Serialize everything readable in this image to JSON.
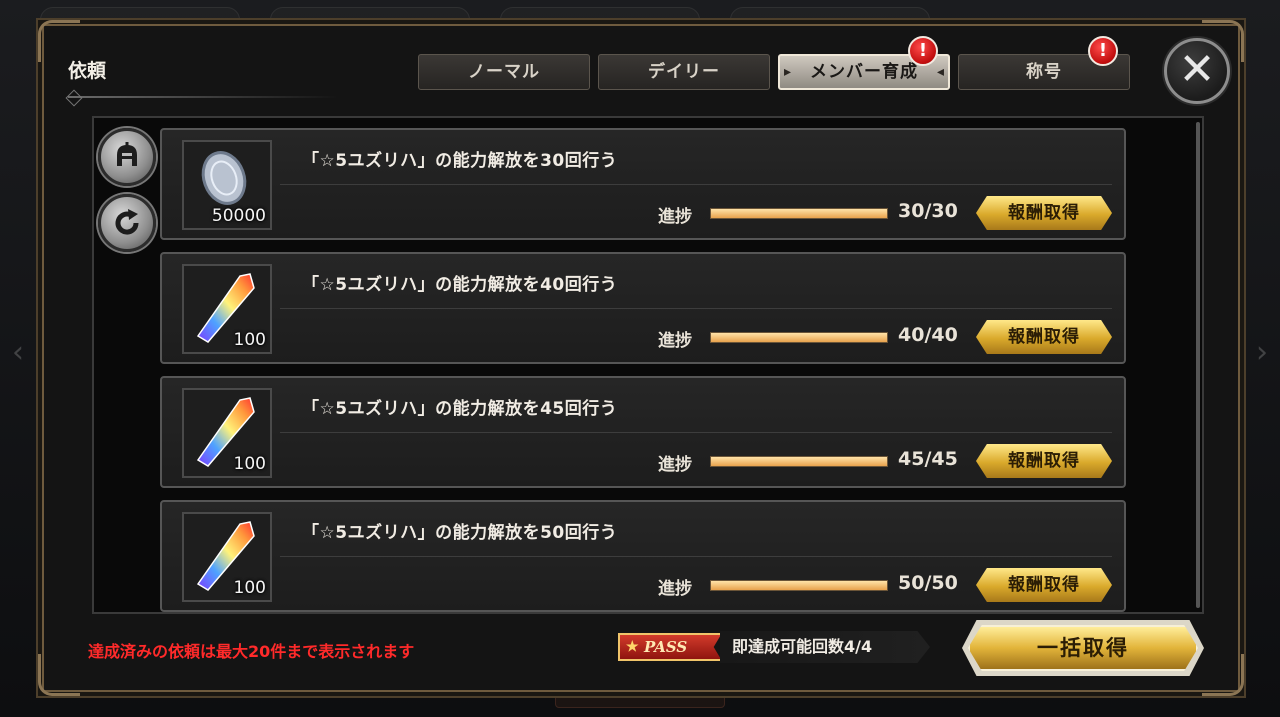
{
  "dialog": {
    "title": "依頼",
    "close_label": "✕"
  },
  "tabs": [
    {
      "label": "ノーマル",
      "active": false,
      "badge": false
    },
    {
      "label": "デイリー",
      "active": false,
      "badge": false
    },
    {
      "label": "メンバー育成",
      "active": true,
      "badge": true
    },
    {
      "label": "称号",
      "active": false,
      "badge": true
    }
  ],
  "badge_symbol": "!",
  "side_buttons": [
    {
      "name": "helmet-icon"
    },
    {
      "name": "refresh-icon"
    }
  ],
  "progress_label": "進捗",
  "quests": [
    {
      "text": "「☆5ユズリハ」の能力解放を30回行う",
      "item_icon": "silver-coin-icon",
      "item_qty": "50000",
      "progress_text": "30/30",
      "progress": 1.0,
      "button": "報酬取得"
    },
    {
      "text": "「☆5ユズリハ」の能力解放を40回行う",
      "item_icon": "rainbow-crystal-icon",
      "item_qty": "100",
      "progress_text": "40/40",
      "progress": 1.0,
      "button": "報酬取得"
    },
    {
      "text": "「☆5ユズリハ」の能力解放を45回行う",
      "item_icon": "rainbow-crystal-icon",
      "item_qty": "100",
      "progress_text": "45/45",
      "progress": 1.0,
      "button": "報酬取得"
    },
    {
      "text": "「☆5ユズリハ」の能力解放を50回行う",
      "item_icon": "rainbow-crystal-icon",
      "item_qty": "100",
      "progress_text": "50/50",
      "progress": 1.0,
      "button": "報酬取得"
    }
  ],
  "footer": {
    "notice": "達成済みの依頼は最大20件まで表示されます",
    "pass_label": "PASS",
    "instant_count": "即達成可能回数4/4",
    "bulk_button": "一括取得"
  },
  "colors": {
    "accent_gold": "#e2b43a",
    "notice_red": "#ff2a2a",
    "badge_red": "#c10d0d",
    "progress_fill": "#e8a24d"
  }
}
